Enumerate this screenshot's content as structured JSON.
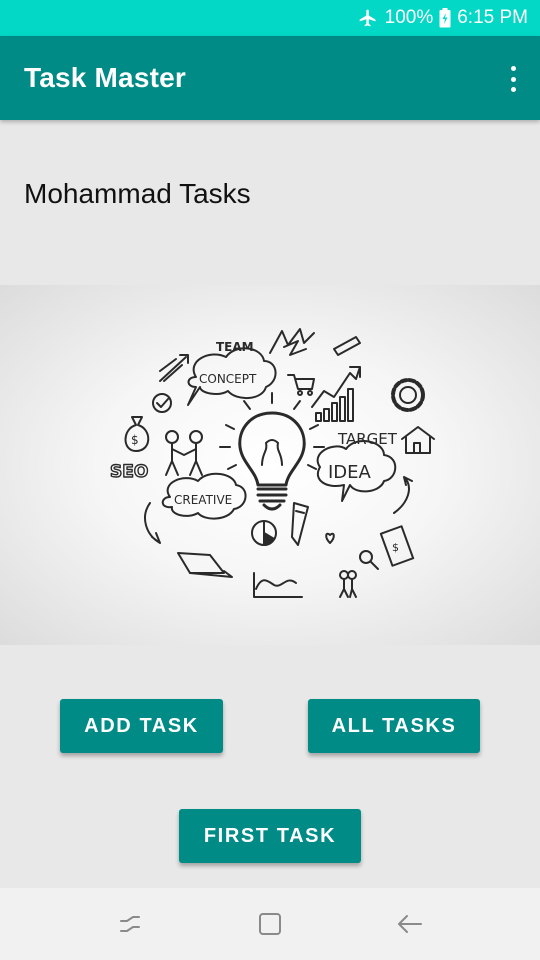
{
  "status_bar": {
    "battery_percent": "100%",
    "time": "6:15 PM",
    "icons": [
      "airplane-mode-icon",
      "battery-charging-icon"
    ]
  },
  "app_bar": {
    "title": "Task Master",
    "overflow_icon": "more-vert-icon"
  },
  "main": {
    "heading": "Mohammad Tasks",
    "hero_image": {
      "description_icon": "lightbulb-idea-illustration",
      "words": [
        "TEAM",
        "CONCEPT",
        "TARGET",
        "IDEA",
        "CREATIVE",
        "SEO"
      ]
    },
    "buttons": {
      "add_task": "ADD TASK",
      "all_tasks": "ALL TASKS",
      "first_task": "FIRST TASK"
    }
  },
  "nav_bar": {
    "icons": [
      "recent-apps-icon",
      "home-icon",
      "back-icon"
    ]
  },
  "colors": {
    "status_bar": "#03d8c6",
    "primary": "#008b86",
    "background": "#e8e8e8"
  }
}
